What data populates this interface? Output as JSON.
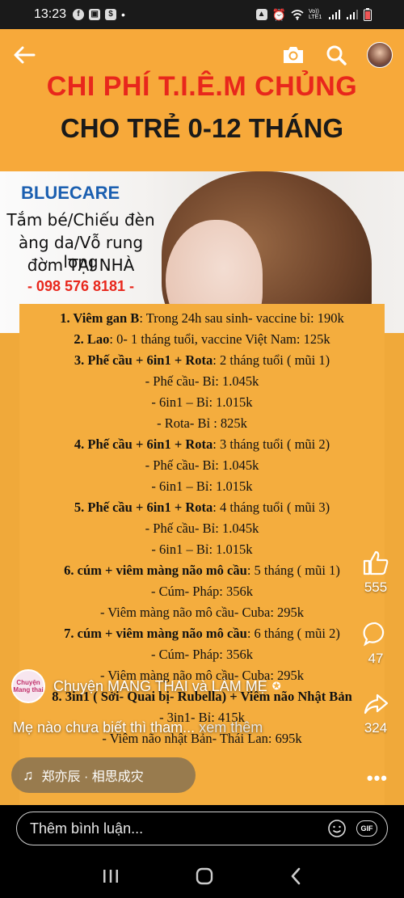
{
  "status_bar": {
    "time": "13:23",
    "left_icons": [
      "facebook-icon",
      "image-icon",
      "store-icon",
      "dot-icon"
    ],
    "right_icons": [
      "alarm-icon",
      "wifi-icon",
      "volte-icon",
      "signal-icon",
      "signal-icon",
      "battery-icon"
    ],
    "volte_label": "Vo)) LTE1"
  },
  "top_bar": {
    "icons": [
      "back-arrow-icon",
      "camera-icon",
      "search-icon",
      "profile-avatar"
    ]
  },
  "poster": {
    "title_line1": "CHI PHÍ T.I.Ê.M CHỦNG",
    "title_line2": "CHO TRẺ 0-12 THÁNG",
    "brand": "BLUECARE",
    "service_line1": "Tắm bé/Chiếu đèn",
    "service_line2": "àng da/Vỗ rung long",
    "service_line3": "đờm TẠI NHÀ",
    "phone": "- 098 576 8181 -",
    "colors": {
      "title_red": "#e8271c",
      "brand_blue": "#1b5fb0",
      "bg_orange": "#f4ad3e"
    },
    "rows": [
      {
        "bold": "1. Viêm gan B",
        "text": ": Trong 24h sau sinh- vaccine bỉ: 190k"
      },
      {
        "bold": "2. Lao",
        "text": ": 0- 1 tháng tuổi, vaccine Việt Nam: 125k"
      },
      {
        "bold": "3. Phế cầu + 6in1 + Rota",
        "text": ": 2 tháng tuổi ( mũi 1)"
      },
      {
        "bold": "",
        "text": "- Phế cầu- Bỉ: 1.045k"
      },
      {
        "bold": "",
        "text": "- 6in1 – Bỉ: 1.015k"
      },
      {
        "bold": "",
        "text": "- Rota- Bỉ : 825k"
      },
      {
        "bold": "4. Phế cầu + 6in1 + Rota",
        "text": ": 3 tháng tuổi ( mũi 2)"
      },
      {
        "bold": "",
        "text": "- Phế cầu- Bỉ: 1.045k"
      },
      {
        "bold": "",
        "text": "- 6in1 – Bỉ: 1.015k"
      },
      {
        "bold": "5. Phế cầu + 6in1 + Rota",
        "text": ": 4 tháng tuổi ( mũi 3)"
      },
      {
        "bold": "",
        "text": "- Phế cầu- Bỉ: 1.045k"
      },
      {
        "bold": "",
        "text": "- 6in1 – Bỉ: 1.015k"
      },
      {
        "bold": "6. cúm + viêm màng não mô cầu",
        "text": ": 5 tháng ( mũi 1)"
      },
      {
        "bold": "",
        "text": "- Cúm- Pháp: 356k"
      },
      {
        "bold": "",
        "text": "- Viêm màng não mô cầu- Cuba: 295k"
      },
      {
        "bold": "7. cúm + viêm màng não mô cầu",
        "text": ": 6 tháng ( mũi 2)"
      },
      {
        "bold": "",
        "text": "- Cúm- Pháp: 356k"
      },
      {
        "bold": "",
        "text": "- Viêm màng não mô cầu- Cuba: 295k"
      },
      {
        "bold": "8. 3in1 ( Sởi- Quai bị- Rubella) + Viêm não Nhật Bản",
        "text": ""
      },
      {
        "bold": "",
        "text": "- 3in1- Bỉ: 415k"
      },
      {
        "bold": "",
        "text": "- Viêm não nhật Bản- Thái Lan: 695k"
      }
    ]
  },
  "rail": {
    "like_count": "555",
    "comment_count": "47",
    "share_count": "324"
  },
  "author": {
    "avatar_text": "Chuyện Mang thai",
    "name": "Chuyện MANG THAI và LÀM MẸ"
  },
  "caption": {
    "text": "Mẹ nào chưa biết thì tham...",
    "more": "xem thêm"
  },
  "music": {
    "label": "郑亦辰 · 相思成灾"
  },
  "comment": {
    "placeholder": "Thêm bình luận...",
    "gif_label": "GIF"
  },
  "nav": {
    "icons": [
      "recent-apps-icon",
      "home-icon",
      "back-icon"
    ]
  }
}
